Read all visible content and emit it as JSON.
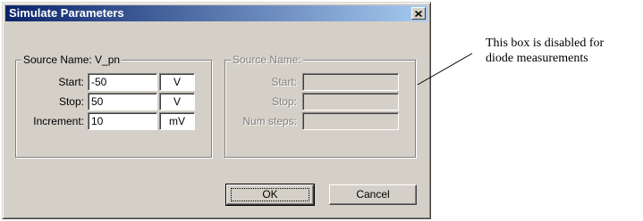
{
  "dialog": {
    "title": "Simulate Parameters",
    "close_glyph": "×"
  },
  "source_group": {
    "legend": "Source Name: V_pn",
    "rows": [
      {
        "label": "Start:",
        "value": "-50",
        "unit": "V"
      },
      {
        "label": "Stop:",
        "value": "50",
        "unit": "V"
      },
      {
        "label": "Increment:",
        "value": "10",
        "unit": "mV"
      }
    ]
  },
  "disabled_group": {
    "legend": "Source Name:",
    "rows": [
      {
        "label": "Start:",
        "value": ""
      },
      {
        "label": "Stop:",
        "value": ""
      },
      {
        "label": "Num steps:",
        "value": ""
      }
    ]
  },
  "buttons": {
    "ok": "OK",
    "cancel": "Cancel"
  },
  "annotation": {
    "line1": "This box is disabled for",
    "line2": "diode measurements"
  },
  "colors": {
    "title_gradient_start": "#0a246a",
    "title_gradient_end": "#a6caf0",
    "dialog_face": "#d4d0c8"
  },
  "icons": {
    "close": "close-icon"
  }
}
